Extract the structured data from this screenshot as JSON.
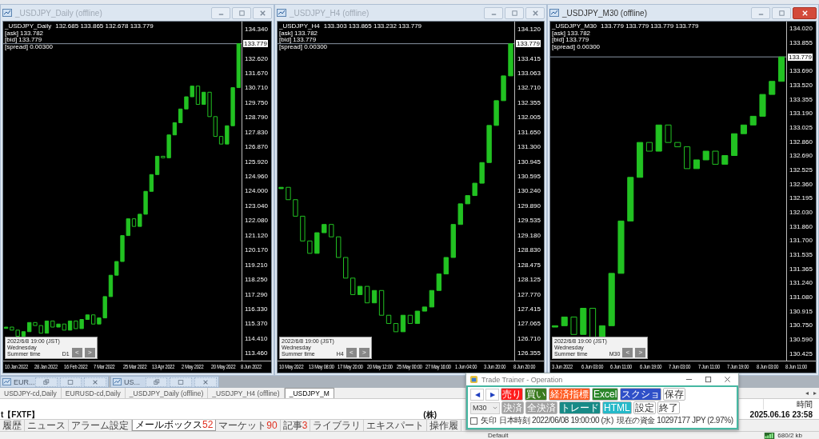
{
  "windows": [
    {
      "title": "_USDJPY_Daily (offline)",
      "active": false,
      "symbol": "_USDJPY_Daily",
      "ohlc": "132.685 133.865 132.678 133.779",
      "header": [
        "[ask] 133.782",
        "[bid] 133.779",
        "[spread] 0.00300"
      ],
      "info_box": {
        "lines": [
          "2022/6/8 19:00 (JST)",
          "Wednesday",
          "Summer time"
        ],
        "timeframe": "D1",
        "prev": "<",
        "next": ">"
      },
      "price_labels": [
        {
          "kind": "tick",
          "label": "134.340"
        },
        {
          "kind": "current",
          "label": "133.779"
        },
        {
          "kind": "tick",
          "label": "132.620"
        },
        {
          "kind": "tick",
          "label": "131.670"
        },
        {
          "kind": "tick",
          "label": "130.710"
        },
        {
          "kind": "tick",
          "label": "129.750"
        },
        {
          "kind": "tick",
          "label": "128.790"
        },
        {
          "kind": "tick",
          "label": "127.830"
        },
        {
          "kind": "tick",
          "label": "126.870"
        },
        {
          "kind": "tick",
          "label": "125.920"
        },
        {
          "kind": "tick",
          "label": "124.960"
        },
        {
          "kind": "tick",
          "label": "124.000"
        },
        {
          "kind": "tick",
          "label": "123.040"
        },
        {
          "kind": "tick",
          "label": "122.080"
        },
        {
          "kind": "tick",
          "label": "121.120"
        },
        {
          "kind": "tick",
          "label": "120.170"
        },
        {
          "kind": "tick",
          "label": "119.210"
        },
        {
          "kind": "tick",
          "label": "118.250"
        },
        {
          "kind": "tick",
          "label": "117.290"
        },
        {
          "kind": "tick",
          "label": "116.330"
        },
        {
          "kind": "tick",
          "label": "115.370"
        },
        {
          "kind": "tick",
          "label": "114.410"
        },
        {
          "kind": "tick",
          "label": "113.460"
        }
      ],
      "time_labels": [
        "10 Jan 2022",
        "28 Jan 2022",
        "16 Feb 2022",
        "7 Mar 2022",
        "25 Mar 2022",
        "13 Apr 2022",
        "2 May 2022",
        "20 May 2022",
        "8 Jun 2022"
      ]
    },
    {
      "title": "_USDJPY_H4 (offline)",
      "active": false,
      "symbol": "_USDJPY_H4",
      "ohlc": "133.303 133.865 133.232 133.779",
      "header": [
        "[ask] 133.782",
        "[bid] 133.779",
        "[spread] 0.00300"
      ],
      "info_box": {
        "lines": [
          "2022/6/8 19:00 (JST)",
          "Wednesday",
          "Summer time"
        ],
        "timeframe": "H4",
        "prev": "<",
        "next": ">"
      },
      "price_labels": [
        {
          "kind": "tick",
          "label": "134.120"
        },
        {
          "kind": "current",
          "label": "133.779"
        },
        {
          "kind": "tick",
          "label": "133.415"
        },
        {
          "kind": "tick",
          "label": "133.063"
        },
        {
          "kind": "tick",
          "label": "132.710"
        },
        {
          "kind": "tick",
          "label": "132.355"
        },
        {
          "kind": "tick",
          "label": "132.005"
        },
        {
          "kind": "tick",
          "label": "131.650"
        },
        {
          "kind": "tick",
          "label": "131.300"
        },
        {
          "kind": "tick",
          "label": "130.945"
        },
        {
          "kind": "tick",
          "label": "130.595"
        },
        {
          "kind": "tick",
          "label": "130.240"
        },
        {
          "kind": "tick",
          "label": "129.890"
        },
        {
          "kind": "tick",
          "label": "129.535"
        },
        {
          "kind": "tick",
          "label": "129.180"
        },
        {
          "kind": "tick",
          "label": "128.830"
        },
        {
          "kind": "tick",
          "label": "128.475"
        },
        {
          "kind": "tick",
          "label": "128.125"
        },
        {
          "kind": "tick",
          "label": "127.770"
        },
        {
          "kind": "tick",
          "label": "127.415"
        },
        {
          "kind": "tick",
          "label": "127.065"
        },
        {
          "kind": "tick",
          "label": "126.710"
        },
        {
          "kind": "tick",
          "label": "126.355"
        }
      ],
      "time_labels": [
        "10 May 2022",
        "13 May 08:00",
        "17 May 20:00",
        "20 May 12:00",
        "25 May 00:00",
        "27 May 16:00",
        "1 Jun 04:00",
        "3 Jun 20:00",
        "8 Jun 20:00"
      ]
    },
    {
      "title": "_USDJPY_M30 (offline)",
      "active": true,
      "symbol": "_USDJPY_M30",
      "ohlc": "133.779 133.779 133.779 133.779",
      "header": [
        "[ask] 133.782",
        "[bid] 133.779",
        "[spread] 0.00300"
      ],
      "info_box": {
        "lines": [
          "2022/6/8 19:00 (JST)",
          "Wednesday",
          "Summer time"
        ],
        "timeframe": "M30",
        "prev": "<",
        "next": ">"
      },
      "price_labels": [
        {
          "kind": "tick",
          "label": "134.020"
        },
        {
          "kind": "tick",
          "label": "133.855"
        },
        {
          "kind": "current",
          "label": "133.779"
        },
        {
          "kind": "tick",
          "label": "133.690"
        },
        {
          "kind": "tick",
          "label": "133.520"
        },
        {
          "kind": "tick",
          "label": "133.355"
        },
        {
          "kind": "tick",
          "label": "133.190"
        },
        {
          "kind": "tick",
          "label": "133.025"
        },
        {
          "kind": "tick",
          "label": "132.860"
        },
        {
          "kind": "tick",
          "label": "132.690"
        },
        {
          "kind": "tick",
          "label": "132.525"
        },
        {
          "kind": "tick",
          "label": "132.360"
        },
        {
          "kind": "tick",
          "label": "132.195"
        },
        {
          "kind": "tick",
          "label": "132.030"
        },
        {
          "kind": "tick",
          "label": "131.860"
        },
        {
          "kind": "tick",
          "label": "131.700"
        },
        {
          "kind": "tick",
          "label": "131.535"
        },
        {
          "kind": "tick",
          "label": "131.365"
        },
        {
          "kind": "tick",
          "label": "131.240"
        },
        {
          "kind": "tick",
          "label": "131.080"
        },
        {
          "kind": "tick",
          "label": "130.915"
        },
        {
          "kind": "tick",
          "label": "130.750"
        },
        {
          "kind": "tick",
          "label": "130.590"
        },
        {
          "kind": "tick",
          "label": "130.425"
        }
      ],
      "time_labels": [
        "3 Jun 2022",
        "6 Jun 03:00",
        "6 Jun 11:00",
        "6 Jun 19:00",
        "7 Jun 03:00",
        "7 Jun 11:00",
        "7 Jun 19:00",
        "8 Jun 03:00",
        "8 Jun 11:00"
      ]
    }
  ],
  "minimized_windows": [
    {
      "title": "EUR..."
    },
    {
      "title": "US..."
    }
  ],
  "document_tabs": [
    {
      "label": "USDJPY-cd,Daily",
      "selected": false
    },
    {
      "label": "EURUSD-cd,Daily",
      "selected": false
    },
    {
      "label": "_USDJPY_Daily (offline)",
      "selected": false
    },
    {
      "label": "_USDJPY_H4 (offline)",
      "selected": false
    },
    {
      "label": "_USDJPY_M",
      "selected": true
    }
  ],
  "tab_scroll": {
    "left": "◂",
    "right": "▸"
  },
  "table": {
    "columns": [
      {
        "label": "時間"
      }
    ],
    "rows": [
      {
        "source": "t【FXTF】",
        "title": "(株)",
        "time": "2025.06.16 23:58"
      }
    ]
  },
  "terminal_tabs": [
    {
      "label": "履歴",
      "selected": false
    },
    {
      "label": "ニュース",
      "selected": false
    },
    {
      "label": "アラーム設定",
      "selected": false
    },
    {
      "label": "メールボックス",
      "count": "52",
      "selected": true
    },
    {
      "label": "マーケット",
      "count": "90",
      "selected": false
    },
    {
      "label": "記事",
      "count": "3",
      "selected": false
    },
    {
      "label": "ライブラリ",
      "selected": false
    },
    {
      "label": "エキスパート",
      "selected": false
    },
    {
      "label": "操作履",
      "selected": false
    }
  ],
  "status_bar": {
    "profile": "Default",
    "traffic": "680/2 kb"
  },
  "dialog": {
    "title": "Trade Trainer - Operation",
    "nav": [
      "◀",
      "▶"
    ],
    "timeframe": "M30",
    "row1": [
      {
        "label": "売り",
        "color": "#ff1b1b"
      },
      {
        "label": "買い",
        "color": "#3b7a1f"
      },
      {
        "label": "経済指標",
        "color": "#ff5a1f"
      },
      {
        "label": "Excel",
        "color": "#2a862a"
      },
      {
        "label": "スクショ",
        "color": "#2f50c8"
      },
      {
        "label": "保存",
        "color": "#ffffff"
      }
    ],
    "row2": [
      {
        "label": "決済",
        "color": "#a2a2a2"
      },
      {
        "label": "全決済",
        "color": "#a2a2a2"
      },
      {
        "label": "トレード",
        "color": "#178a86"
      },
      {
        "label": "HTML",
        "color": "#25b9c9"
      },
      {
        "label": "設定",
        "color": "#ffffff"
      },
      {
        "label": "終了",
        "color": "#ffffff"
      }
    ],
    "arrow_checkbox": {
      "label": "矢印",
      "checked": false
    },
    "japan_time": "日本時刻 2022/06/08 19:00:00 (水)",
    "funds": "現在の資金 10297177 JPY (2.97%)"
  }
}
